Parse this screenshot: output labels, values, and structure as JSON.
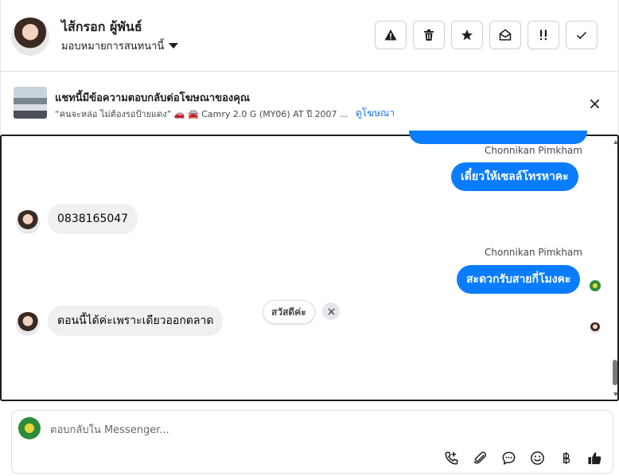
{
  "header": {
    "contact_name": "ไส้กรอก ผู้พันธ์",
    "assign_label": "มอบหมายการสนทนานี้",
    "toolbar": [
      {
        "name": "report-button",
        "icon": "warning-icon"
      },
      {
        "name": "delete-button",
        "icon": "trash-icon"
      },
      {
        "name": "star-button",
        "icon": "star-icon"
      },
      {
        "name": "mark-unread-button",
        "icon": "envelope-open-icon"
      },
      {
        "name": "follow-up-button",
        "icon": "exclamation-icon"
      },
      {
        "name": "done-button",
        "icon": "check-icon"
      }
    ]
  },
  "ad_banner": {
    "title": "แชทนี้มีข้อความตอบกลับต่อโฆษณาของคุณ",
    "subtitle": "“คนจะหล่อ ไม่ต้องรอป้ายแดง” 🚗 🚘 Camry 2.0 G (MY06) AT ปี 2007 ...",
    "link": "ดูโฆษณา"
  },
  "messages": [
    {
      "sender": "Chonnikan Pimkham",
      "text": "เดี๋ยวให้เซลล์โทรหาคะ",
      "direction": "out"
    },
    {
      "text": "0838165047",
      "direction": "in"
    },
    {
      "sender": "Chonnikan Pimkham",
      "text": "สะดวกรับสายกี่โมงคะ",
      "direction": "out"
    },
    {
      "text": "ตอนนี้ได้ค่ะเพราะเดียวออกตลาด",
      "direction": "in"
    }
  ],
  "quick_reply": {
    "label": "สวัสดีค่ะ"
  },
  "composer": {
    "placeholder": "ตอบกลับใน Messenger...",
    "tools": [
      "call-icon",
      "attachment-icon",
      "saved-reply-icon",
      "emoji-icon",
      "baht-icon",
      "thumbs-up-icon"
    ]
  },
  "colors": {
    "outgoing_bubble": "#0a7cff",
    "incoming_bubble": "#f0f0f0",
    "link": "#1877f2"
  }
}
